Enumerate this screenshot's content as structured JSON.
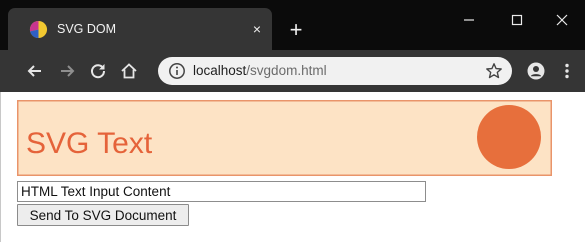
{
  "tab": {
    "title": "SVG DOM",
    "close_label": "×",
    "new_tab_label": "+"
  },
  "window_controls": {
    "minimize_label": "–",
    "close_label": "✕"
  },
  "toolbar": {
    "url_host": "localhost",
    "url_path": "/svgdom.html"
  },
  "page": {
    "svg_text": "SVG Text",
    "input_value": "HTML Text Input Content",
    "button_label": "Send To SVG Document"
  },
  "colors": {
    "svg_background": "#fde3c5",
    "svg_border": "#e9946a",
    "svg_text": "#e5633a",
    "circle_fill": "#e76f3c",
    "titlebar": "#0b0b0b",
    "toolbar": "#353535"
  },
  "icons": {
    "favicon": "svg-dom-favicon-icon",
    "back": "back-arrow-icon",
    "forward": "forward-arrow-icon",
    "reload": "reload-icon",
    "home": "home-icon",
    "site_info": "info-circle-icon",
    "bookmark": "star-outline-icon",
    "profile": "account-circle-icon",
    "menu": "kebab-menu-icon"
  }
}
